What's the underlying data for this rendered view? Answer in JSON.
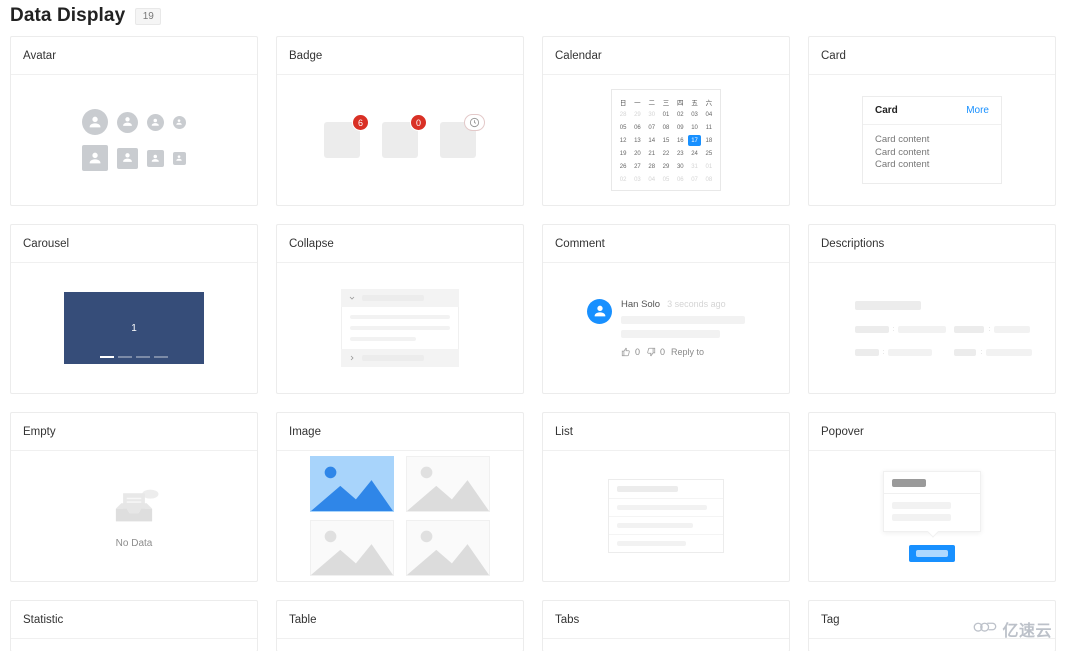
{
  "header": {
    "title": "Data Display",
    "badge": "19"
  },
  "cards": {
    "avatar": {
      "title": "Avatar"
    },
    "badge": {
      "title": "Badge",
      "values": [
        "6",
        "0"
      ],
      "third_icon": "clock-icon"
    },
    "calendar": {
      "title": "Calendar"
    },
    "card": {
      "title": "Card"
    },
    "carousel": {
      "title": "Carousel"
    },
    "collapse": {
      "title": "Collapse"
    },
    "comment": {
      "title": "Comment"
    },
    "descriptions": {
      "title": "Descriptions"
    },
    "empty": {
      "title": "Empty"
    },
    "image": {
      "title": "Image"
    },
    "list": {
      "title": "List"
    },
    "popover": {
      "title": "Popover"
    },
    "statistic": {
      "title": "Statistic"
    },
    "table": {
      "title": "Table"
    },
    "tabs": {
      "title": "Tabs"
    },
    "tag": {
      "title": "Tag"
    }
  },
  "calendar": {
    "weekdays": [
      "日",
      "一",
      "二",
      "三",
      "四",
      "五",
      "六"
    ],
    "weeks": [
      [
        {
          "d": "28",
          "dim": true
        },
        {
          "d": "29",
          "dim": true
        },
        {
          "d": "30",
          "dim": true
        },
        {
          "d": "01"
        },
        {
          "d": "02"
        },
        {
          "d": "03"
        },
        {
          "d": "04"
        }
      ],
      [
        {
          "d": "05"
        },
        {
          "d": "06"
        },
        {
          "d": "07"
        },
        {
          "d": "08"
        },
        {
          "d": "09"
        },
        {
          "d": "10"
        },
        {
          "d": "11"
        }
      ],
      [
        {
          "d": "12"
        },
        {
          "d": "13"
        },
        {
          "d": "14"
        },
        {
          "d": "15"
        },
        {
          "d": "16"
        },
        {
          "d": "17",
          "selected": true
        },
        {
          "d": "18"
        }
      ],
      [
        {
          "d": "19"
        },
        {
          "d": "20"
        },
        {
          "d": "21"
        },
        {
          "d": "22"
        },
        {
          "d": "23"
        },
        {
          "d": "24"
        },
        {
          "d": "25"
        }
      ],
      [
        {
          "d": "26"
        },
        {
          "d": "27"
        },
        {
          "d": "28"
        },
        {
          "d": "29"
        },
        {
          "d": "30"
        },
        {
          "d": "31",
          "dim": true
        },
        {
          "d": "01",
          "dim": true
        }
      ],
      [
        {
          "d": "02",
          "dim": true
        },
        {
          "d": "03",
          "dim": true
        },
        {
          "d": "04",
          "dim": true
        },
        {
          "d": "05",
          "dim": true
        },
        {
          "d": "06",
          "dim": true
        },
        {
          "d": "07",
          "dim": true
        },
        {
          "d": "08",
          "dim": true
        }
      ]
    ],
    "selected_day": "17"
  },
  "mini_card": {
    "title": "Card",
    "more_label": "More",
    "lines": [
      "Card content",
      "Card content",
      "Card content"
    ]
  },
  "carousel": {
    "slide_label": "1",
    "dot_count": 4,
    "active_dot": 1
  },
  "comment": {
    "author": "Han Solo",
    "time": "3 seconds ago",
    "like_count": "0",
    "dislike_count": "0",
    "reply_label": "Reply to"
  },
  "empty": {
    "text": "No Data"
  },
  "colors": {
    "accent_blue": "#1890ff",
    "badge_red": "#d93025",
    "carousel_bg": "#364d79",
    "skeleton": "#ececec",
    "border": "#ececec",
    "text": "#333333"
  },
  "watermark": {
    "text": "亿速云",
    "icon": "cloud-icon"
  }
}
